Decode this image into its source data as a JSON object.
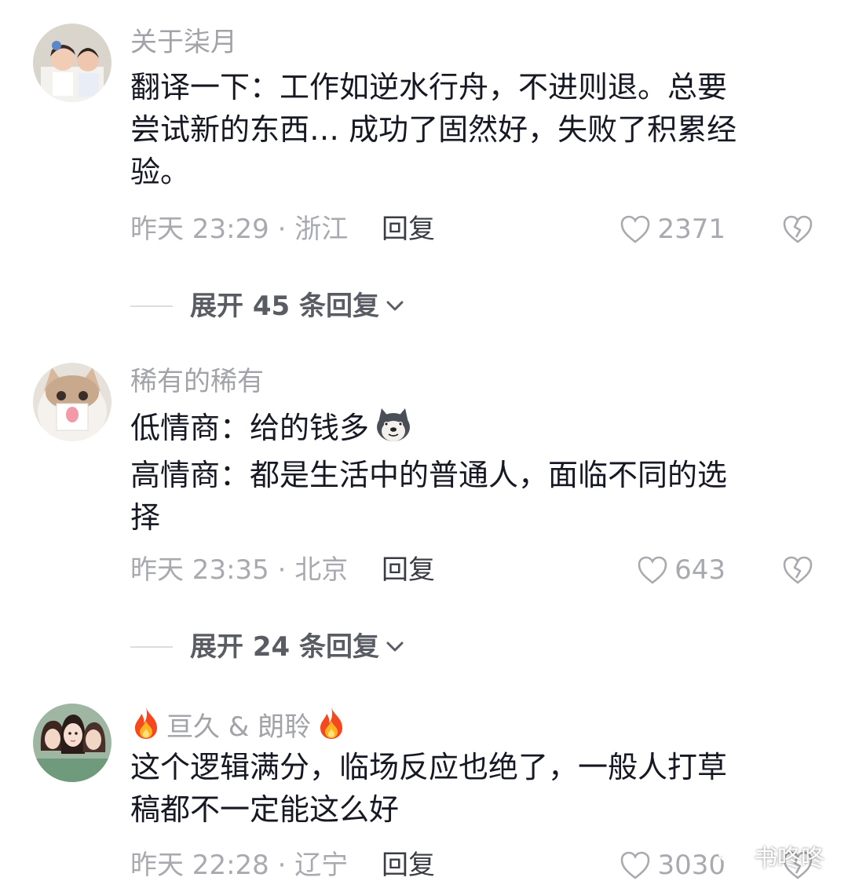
{
  "comments": [
    {
      "username": "关于柒月",
      "lines": [
        "翻译一下：工作如逆水行舟，不进则退。总要",
        "尝试新的东西… 成功了固然好，失败了积累经",
        "验。"
      ],
      "meta": "昨天 23:29 · 浙江",
      "reply_label": "回复",
      "likes": "2371",
      "expand_label": "展开 45 条回复"
    },
    {
      "username": "稀有的稀有",
      "lines": [
        "低情商：给的钱多",
        "高情商：都是生活中的普通人，面临不同的选",
        "择"
      ],
      "meta": "昨天 23:35 · 北京",
      "reply_label": "回复",
      "likes": "643",
      "expand_label": "展开 24 条回复"
    },
    {
      "username_prefix_icon": "fire-emoji",
      "username": "亘久 & 朗聆",
      "username_suffix_icon": "fire-emoji",
      "lines": [
        "这个逻辑满分，临场反应也绝了，一般人打草",
        "稿都不一定能这么好"
      ],
      "meta": "昨天 22:28 · 辽宁",
      "reply_label": "回复",
      "likes": "3030"
    }
  ],
  "emoji_after_line_2_1": "dog-emoji",
  "watermark": {
    "icon": "wechat-icon",
    "text": "书咚咚"
  },
  "colors": {
    "text": "#161823",
    "secondary": "#a8aab0",
    "reply": "#3a3c44"
  }
}
